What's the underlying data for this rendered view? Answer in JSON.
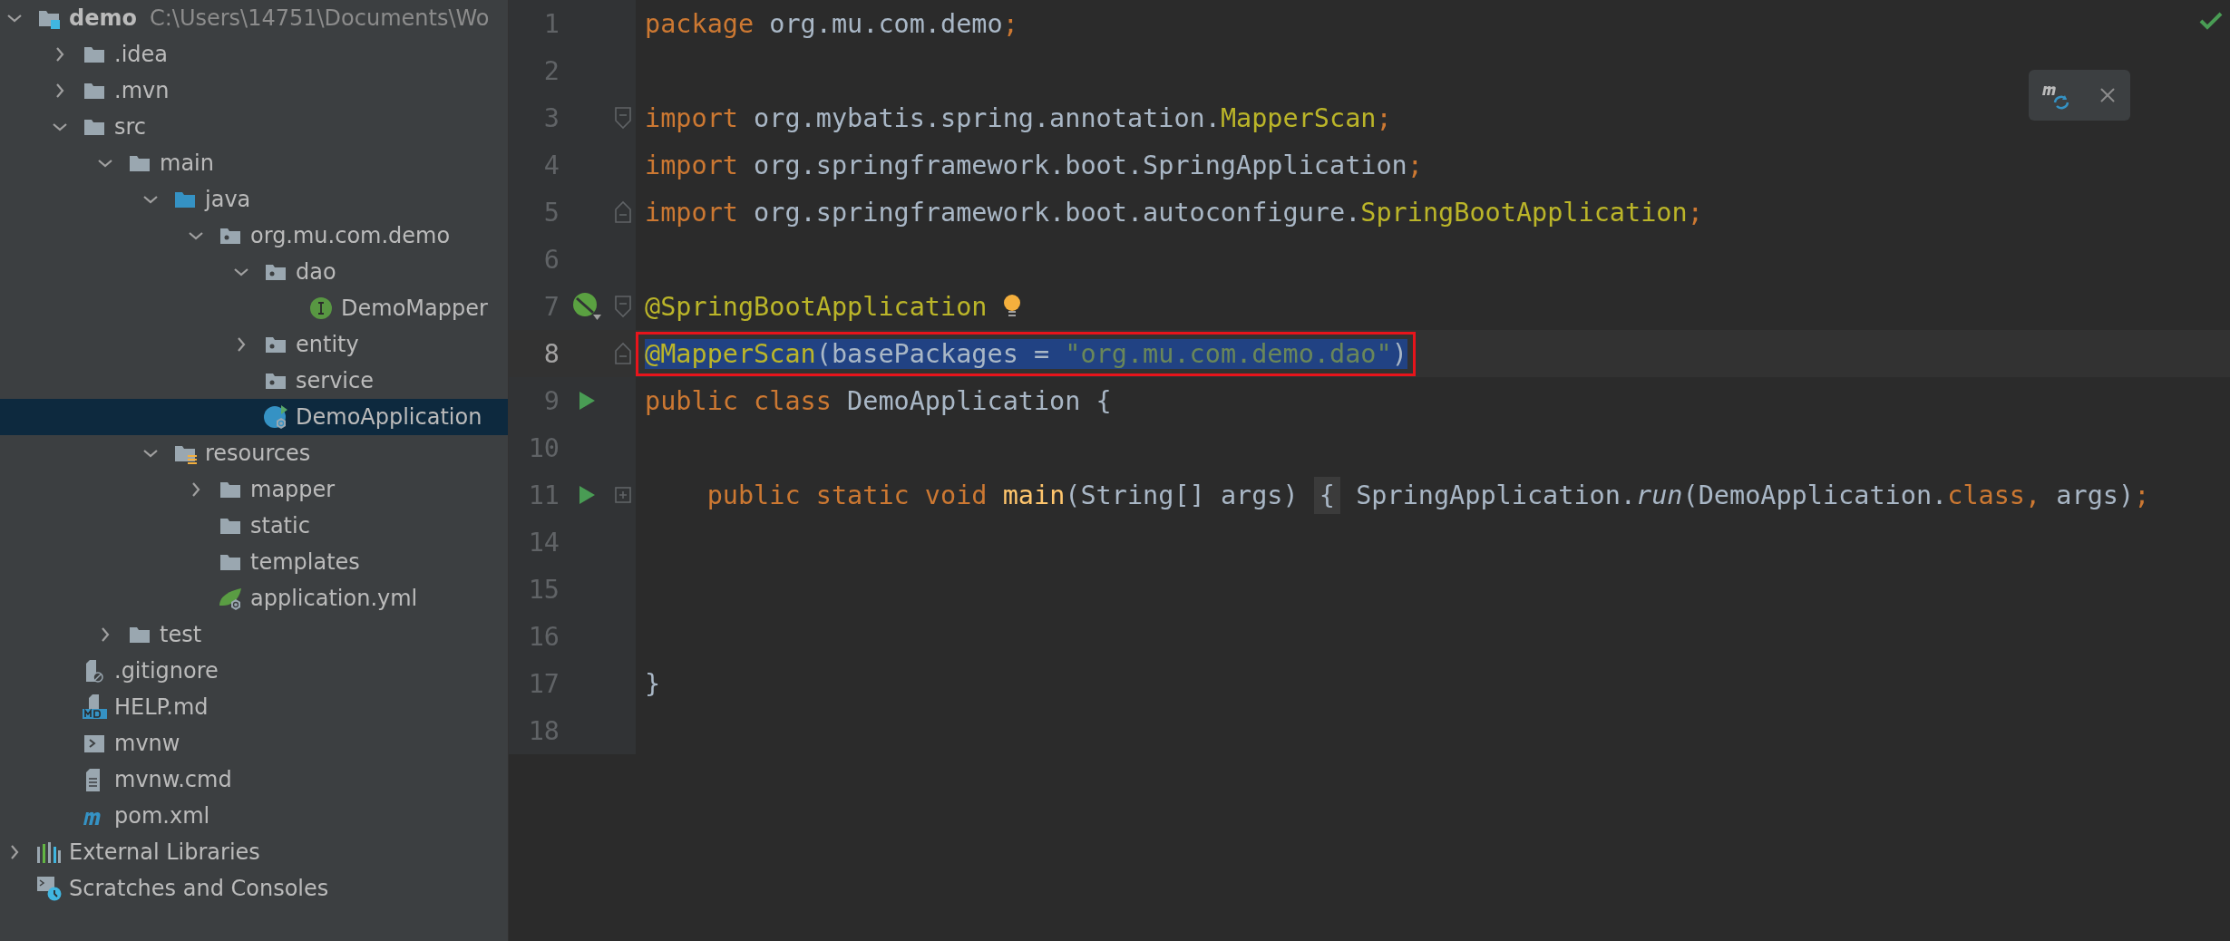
{
  "project_tree": [
    {
      "label": "demo",
      "path": "C:\\Users\\14751\\Documents\\Wo",
      "kind": "module",
      "expanded": true,
      "selected": false,
      "children": [
        {
          "label": ".idea",
          "kind": "folder",
          "expanded": false,
          "selected": false
        },
        {
          "label": ".mvn",
          "kind": "folder",
          "expanded": false,
          "selected": false
        },
        {
          "label": "src",
          "kind": "folder",
          "expanded": true,
          "selected": false,
          "children": [
            {
              "label": "main",
              "kind": "folder",
              "expanded": true,
              "selected": false,
              "children": [
                {
                  "label": "java",
                  "kind": "source",
                  "expanded": true,
                  "selected": false,
                  "children": [
                    {
                      "label": "org.mu.com.demo",
                      "kind": "package",
                      "expanded": true,
                      "selected": false,
                      "children": [
                        {
                          "label": "dao",
                          "kind": "package",
                          "expanded": true,
                          "selected": false,
                          "children": [
                            {
                              "label": "DemoMapper",
                              "kind": "interface",
                              "selected": false
                            }
                          ]
                        },
                        {
                          "label": "entity",
                          "kind": "package",
                          "expanded": false,
                          "selected": false
                        },
                        {
                          "label": "service",
                          "kind": "package",
                          "selected": false
                        },
                        {
                          "label": "DemoApplication",
                          "kind": "application",
                          "selected": true
                        }
                      ]
                    }
                  ]
                },
                {
                  "label": "resources",
                  "kind": "resources",
                  "expanded": true,
                  "selected": false,
                  "children": [
                    {
                      "label": "mapper",
                      "kind": "folder",
                      "expanded": false,
                      "selected": false
                    },
                    {
                      "label": "static",
                      "kind": "folder",
                      "selected": false
                    },
                    {
                      "label": "templates",
                      "kind": "folder",
                      "selected": false
                    },
                    {
                      "label": "application.yml",
                      "kind": "config",
                      "selected": false
                    }
                  ]
                }
              ]
            },
            {
              "label": "test",
              "kind": "folder",
              "expanded": false,
              "selected": false
            }
          ]
        },
        {
          "label": ".gitignore",
          "kind": "ignore",
          "selected": false
        },
        {
          "label": "HELP.md",
          "kind": "markdown",
          "selected": false
        },
        {
          "label": "mvnw",
          "kind": "script",
          "selected": false
        },
        {
          "label": "mvnw.cmd",
          "kind": "text",
          "selected": false
        },
        {
          "label": "pom.xml",
          "kind": "maven",
          "selected": false
        }
      ]
    },
    {
      "label": "External Libraries",
      "kind": "libraries",
      "expanded": false,
      "selected": false
    },
    {
      "label": "Scratches and Consoles",
      "kind": "scratches",
      "selected": false
    }
  ],
  "editor": {
    "lines": [
      {
        "number": "1",
        "selected": false,
        "current": false,
        "boxed": false,
        "tokens": [
          {
            "text": "package",
            "kind": "keyword"
          },
          {
            "text": " org.mu.com.demo",
            "kind": "plain"
          },
          {
            "text": ";",
            "kind": "punct"
          }
        ]
      },
      {
        "number": "2",
        "current": false
      },
      {
        "number": "3",
        "selected": false,
        "current": false,
        "boxed": false,
        "fold": {
          "kind": "start"
        },
        "tokens": [
          {
            "text": "import",
            "kind": "keyword"
          },
          {
            "text": " org.mybatis.spring.annotation.",
            "kind": "plain"
          },
          {
            "text": "MapperScan",
            "kind": "annotation"
          },
          {
            "text": ";",
            "kind": "punct"
          }
        ]
      },
      {
        "number": "4",
        "selected": false,
        "current": false,
        "boxed": false,
        "tokens": [
          {
            "text": "import",
            "kind": "keyword"
          },
          {
            "text": " org.springframework.boot.SpringApplication",
            "kind": "plain"
          },
          {
            "text": ";",
            "kind": "punct"
          }
        ]
      },
      {
        "number": "5",
        "selected": false,
        "current": false,
        "boxed": false,
        "fold": {
          "kind": "end"
        },
        "tokens": [
          {
            "text": "import",
            "kind": "keyword"
          },
          {
            "text": " org.springframework.boot.autoconfigure.",
            "kind": "plain"
          },
          {
            "text": "SpringBootApplication",
            "kind": "annotation"
          },
          {
            "text": ";",
            "kind": "punct"
          }
        ]
      },
      {
        "number": "6",
        "current": false
      },
      {
        "number": "7",
        "selected": false,
        "current": false,
        "boxed": false,
        "fold": {
          "kind": "start"
        },
        "marker": {
          "kind": "bean"
        },
        "bulb": true,
        "tokens": [
          {
            "text": "@SpringBootApplication",
            "kind": "annotation"
          }
        ]
      },
      {
        "number": "8",
        "selected": true,
        "current": true,
        "boxed": true,
        "fold": {
          "kind": "end"
        },
        "tokens": [
          {
            "text": "@MapperScan",
            "kind": "annotation"
          },
          {
            "text": "(basePackages = ",
            "kind": "plain"
          },
          {
            "text": "\"org.mu.com.demo.dao\"",
            "kind": "string"
          },
          {
            "text": ")",
            "kind": "plain"
          }
        ]
      },
      {
        "number": "9",
        "selected": false,
        "current": false,
        "boxed": false,
        "marker": {
          "kind": "run"
        },
        "tokens": [
          {
            "text": "public class ",
            "kind": "keyword"
          },
          {
            "text": "DemoApplication {",
            "kind": "plain"
          }
        ]
      },
      {
        "number": "10",
        "current": false
      },
      {
        "number": "11",
        "selected": false,
        "current": false,
        "boxed": false,
        "fold": {
          "kind": "collapsed"
        },
        "marker": {
          "kind": "run"
        },
        "tokens": [
          {
            "text": "    public static void ",
            "kind": "keyword"
          },
          {
            "text": "main",
            "kind": "method"
          },
          {
            "text": "(String[] args) ",
            "kind": "plain"
          },
          {
            "text": "{",
            "kind": "folded"
          },
          {
            "text": " SpringApplication.",
            "kind": "plain"
          },
          {
            "text": "run",
            "kind": "italic"
          },
          {
            "text": "(DemoApplication.",
            "kind": "plain"
          },
          {
            "text": "class",
            "kind": "keyword"
          },
          {
            "text": ", ",
            "kind": "punct"
          },
          {
            "text": "args)",
            "kind": "plain"
          },
          {
            "text": ";",
            "kind": "punct"
          }
        ]
      },
      {
        "number": "14",
        "current": false
      },
      {
        "number": "15",
        "current": false
      },
      {
        "number": "16",
        "current": false
      },
      {
        "number": "17",
        "selected": false,
        "current": false,
        "boxed": false,
        "tokens": [
          {
            "text": "}",
            "kind": "plain"
          }
        ]
      },
      {
        "number": "18",
        "current": false
      }
    ]
  }
}
